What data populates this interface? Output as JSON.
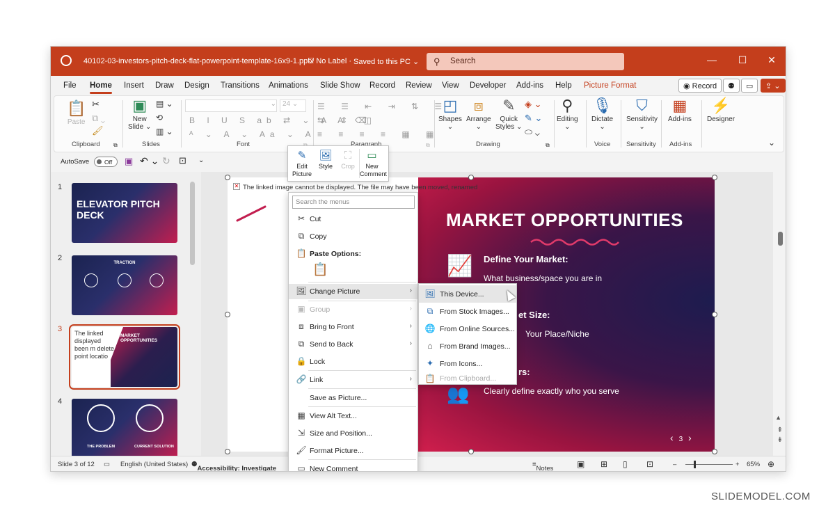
{
  "titlebar": {
    "filename": "40102-03-investors-pitch-deck-flat-powerpoint-template-16x9-1.pptx",
    "label": "No Label",
    "saved": "Saved to this PC",
    "search_placeholder": "Search",
    "minimize": "—",
    "maximize": "☐",
    "close": "✕"
  },
  "tabs": [
    "File",
    "Home",
    "Insert",
    "Draw",
    "Design",
    "Transitions",
    "Animations",
    "Slide Show",
    "Record",
    "Review",
    "View",
    "Developer",
    "Add-ins",
    "Help",
    "Picture Format"
  ],
  "tab_actions": {
    "record": "Record"
  },
  "ribbon": {
    "clipboard": {
      "paste": "Paste",
      "group": "Clipboard"
    },
    "slides": {
      "new": "New",
      "slide": "Slide",
      "group": "Slides"
    },
    "font": {
      "size": "24",
      "group": "Font"
    },
    "paragraph": {
      "group": "Paragraph"
    },
    "drawing": {
      "shapes": "Shapes",
      "arrange": "Arrange",
      "quick": "Quick",
      "styles": "Styles",
      "group": "Drawing"
    },
    "editing": {
      "label": "Editing"
    },
    "voice": {
      "dictate": "Dictate",
      "group": "Voice"
    },
    "sensitivity": {
      "label": "Sensitivity",
      "group": "Sensitivity"
    },
    "addins": {
      "label": "Add-ins",
      "group": "Add-ins"
    },
    "designer": {
      "label": "Designer"
    }
  },
  "qat": {
    "autosave": "AutoSave",
    "toggle": "Off"
  },
  "mini_toolbar": {
    "edit": "Edit",
    "picture": "Picture",
    "style": "Style",
    "crop": "Crop",
    "new": "New",
    "comment": "Comment"
  },
  "thumbnails": {
    "n1": "1",
    "n2": "2",
    "n3": "3",
    "n4": "4",
    "t1": "ELEVATOR PITCH DECK",
    "t2": "TRACTION",
    "t3_err": "The linked displayed been m delete point locatio",
    "t3": "MARKET OPPORTUNITIES",
    "t4a": "THE PROBLEM",
    "t4b": "CURRENT SOLUTION"
  },
  "slide": {
    "error": "The linked image cannot be displayed.  The file may have been moved, renamed",
    "title": "MARKET OPPORTUNITIES",
    "h1": "Define Your Market:",
    "t1": "What business/space you are in",
    "h2": "et Size:",
    "t2": "Your Place/Niche",
    "h3": "rs:",
    "t3": "Clearly define exactly who you serve",
    "page": "3"
  },
  "context_menu": {
    "search_placeholder": "Search the menus",
    "cut": "Cut",
    "copy": "Copy",
    "paste_options": "Paste Options:",
    "change_picture": "Change Picture",
    "group": "Group",
    "bring_front": "Bring to Front",
    "send_back": "Send to Back",
    "lock": "Lock",
    "link": "Link",
    "save_as_picture": "Save as Picture...",
    "alt_text": "View Alt Text...",
    "size_position": "Size and Position...",
    "format_picture": "Format Picture...",
    "new_comment": "New Comment"
  },
  "submenu": {
    "device": "This Device...",
    "stock": "From Stock Images...",
    "online": "From Online Sources...",
    "brand": "From Brand Images...",
    "icons": "From Icons...",
    "clipboard": "From Clipboard..."
  },
  "status": {
    "slide_of": "Slide 3 of 12",
    "language": "English (United States)",
    "accessibility": "Accessibility: Investigate",
    "notes": "Notes",
    "zoom": "65%"
  },
  "watermark": "SLIDEMODEL.COM",
  "colors": {
    "accent": "#c43e1c",
    "slide_dark": "#1d1c4f",
    "slide_red": "#d11f4d"
  }
}
